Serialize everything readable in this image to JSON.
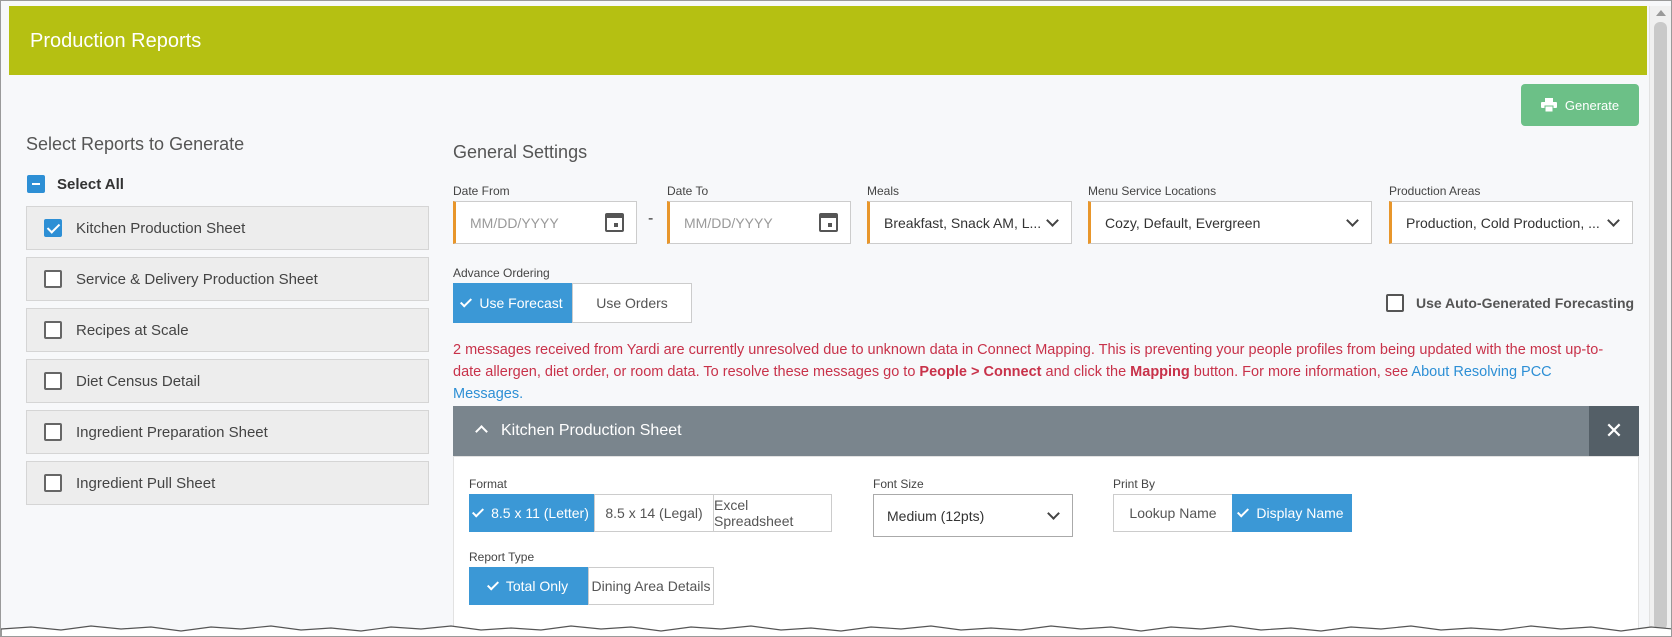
{
  "header": {
    "title": "Production Reports"
  },
  "toolbar": {
    "generate_label": "Generate"
  },
  "reports": {
    "title": "Select Reports to Generate",
    "select_all_label": "Select All",
    "items": [
      {
        "label": "Kitchen Production Sheet",
        "checked": true
      },
      {
        "label": "Service & Delivery Production Sheet",
        "checked": false
      },
      {
        "label": "Recipes at Scale",
        "checked": false
      },
      {
        "label": "Diet Census Detail",
        "checked": false
      },
      {
        "label": "Ingredient Preparation Sheet",
        "checked": false
      },
      {
        "label": "Ingredient Pull Sheet",
        "checked": false
      }
    ]
  },
  "settings": {
    "title": "General Settings",
    "date_from": {
      "label": "Date From",
      "placeholder": "MM/DD/YYYY"
    },
    "date_separator": "-",
    "date_to": {
      "label": "Date To",
      "placeholder": "MM/DD/YYYY"
    },
    "meals": {
      "label": "Meals",
      "value": "Breakfast, Snack AM, L..."
    },
    "locations": {
      "label": "Menu Service Locations",
      "value": "Cozy, Default, Evergreen"
    },
    "areas": {
      "label": "Production Areas",
      "value": "Production, Cold Production, ..."
    },
    "advance_ordering": {
      "label": "Advance Ordering",
      "options": [
        "Use Forecast",
        "Use Orders"
      ],
      "selected": "Use Forecast"
    },
    "auto_forecast_label": "Use Auto-Generated Forecasting"
  },
  "warning": {
    "part1": "2 messages received from Yardi are currently unresolved due to unknown data in Connect Mapping. This is preventing your people profiles from being updated with the most up-to-date allergen, diet order, or room data. To resolve these messages go to ",
    "bold1": "People > Connect",
    "part2": " and click the ",
    "bold2": "Mapping",
    "part3": " button. For more information, see ",
    "link": "About Resolving PCC Messages."
  },
  "panel": {
    "title": "Kitchen Production Sheet",
    "close_label": "✕",
    "format": {
      "label": "Format",
      "options": [
        "8.5 x 11 (Letter)",
        "8.5 x 14 (Legal)",
        "Excel Spreadsheet"
      ],
      "selected": "8.5 x 11 (Letter)"
    },
    "font_size": {
      "label": "Font Size",
      "value": "Medium (12pts)"
    },
    "print_by": {
      "label": "Print By",
      "options": [
        "Lookup Name",
        "Display Name"
      ],
      "selected": "Display Name"
    },
    "report_type": {
      "label": "Report Type",
      "options": [
        "Total Only",
        "Dining Area Details"
      ],
      "selected": "Total Only"
    }
  },
  "colors": {
    "header": "#b5c012",
    "generate": "#6cc087",
    "accent_blue": "#3b98d6",
    "field_accent": "#e8962b",
    "warning": "#c8324a",
    "panel_head": "#7a858d"
  }
}
